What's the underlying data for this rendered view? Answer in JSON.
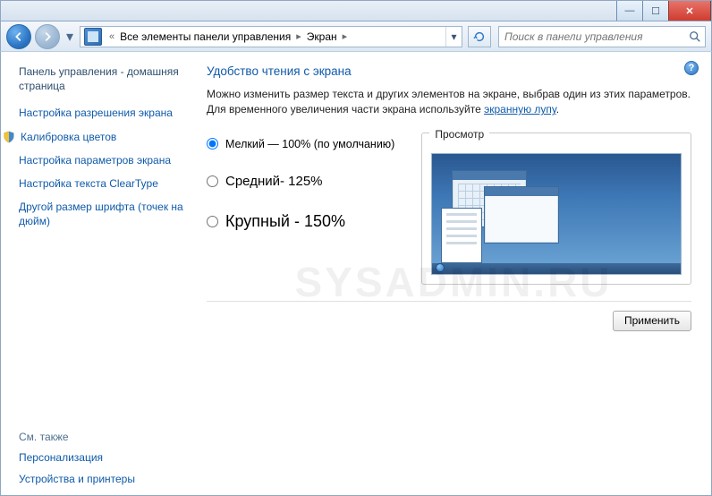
{
  "titlebar": {
    "min_glyph": "—",
    "max_glyph": "☐",
    "close_glyph": "✕"
  },
  "nav": {
    "breadcrumb_prefix": "«",
    "breadcrumb_root": "Все элементы панели управления",
    "breadcrumb_current": "Экран"
  },
  "search": {
    "placeholder": "Поиск в панели управления"
  },
  "sidebar": {
    "home": "Панель управления - домашняя страница",
    "links": [
      "Настройка разрешения экрана",
      "Калибровка цветов",
      "Настройка параметров экрана",
      "Настройка текста ClearType",
      "Другой размер шрифта (точек на дюйм)"
    ],
    "shield_index": 1,
    "see_also_title": "См. также",
    "see_also": [
      "Персонализация",
      "Устройства и принтеры"
    ]
  },
  "main": {
    "title": "Удобство чтения с экрана",
    "desc_part1": "Можно изменить размер текста и других элементов на экране, выбрав один из этих параметров. Для временного увеличения части экрана используйте ",
    "desc_link": "экранную лупу",
    "desc_part2": ".",
    "options": [
      {
        "label": "Мелкий — 100% (по умолчанию)",
        "selected": true
      },
      {
        "label": "Средний- 125%",
        "selected": false
      },
      {
        "label": "Крупный - 150%",
        "selected": false
      }
    ],
    "preview_label": "Просмотр",
    "apply_label": "Применить"
  },
  "watermark": "SYSADMIN.RU"
}
